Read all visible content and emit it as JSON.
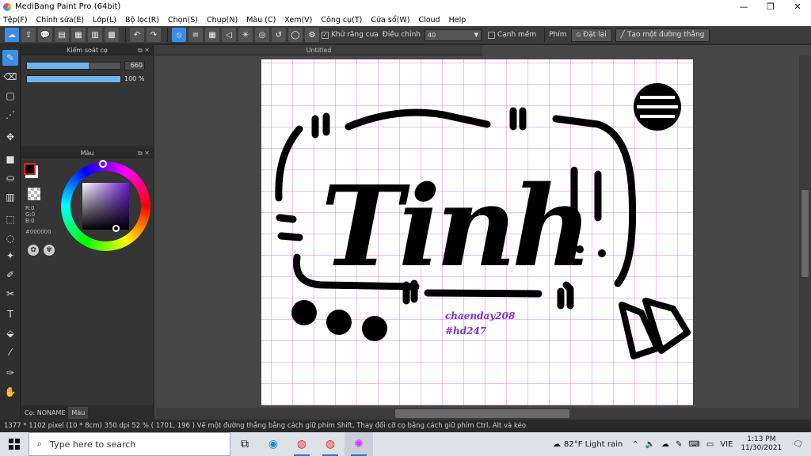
{
  "window": {
    "title": "MediBang Paint Pro (64bit)"
  },
  "menu": [
    "Tệp(F)",
    "Chỉnh sửa(E)",
    "Lớp(L)",
    "Bộ lọc(R)",
    "Chọn(S)",
    "Chụp(N)",
    "Màu (C)",
    "Xem(V)",
    "Công cụ(T)",
    "Cửa sổ(W)",
    "Cloud",
    "Help"
  ],
  "toolbar": {
    "antialias_label": "Khử răng cưa",
    "adjust_label": "Điều chỉnh",
    "adjust_value": "40",
    "edge_label": "Cạnh mềm",
    "key_label": "Phím",
    "reset_label": "Đặt lại",
    "straight_label": "Tạo một đường thẳng"
  },
  "brush_panel": {
    "title": "Kiểm soát cọ",
    "size_value": "660",
    "size_fraction": 0.66,
    "opacity_value": "100 %",
    "opacity_fraction": 1.0
  },
  "color_panel": {
    "title": "Màu",
    "r": "R:0",
    "g": "G:0",
    "b": "B:0",
    "hex": "#000000"
  },
  "bottom_tabs": {
    "brush": "Cọ: NONAME",
    "color": "Màu"
  },
  "document": {
    "tab_title": "Untitled",
    "main_text": "Tinh",
    "credit_1": "chaenday208",
    "credit_2": "#hd247",
    "ink_color": "#000000",
    "credit_color": "#7b2ee0"
  },
  "status": {
    "text": "1377 * 1102 pixel   (10 * 8cm)   350 dpi   52 %   ( 1701, 196 )   Vẽ một đường thẳng bằng cách giữ phím Shift, Thay đổi cỡ cọ bằng cách giữ phím Ctrl, Alt và kéo"
  },
  "taskbar": {
    "search_placeholder": "Type here to search",
    "weather": "82°F  Light rain",
    "lang": "VIE",
    "time": "1:13 PM",
    "date": "11/30/2021"
  }
}
